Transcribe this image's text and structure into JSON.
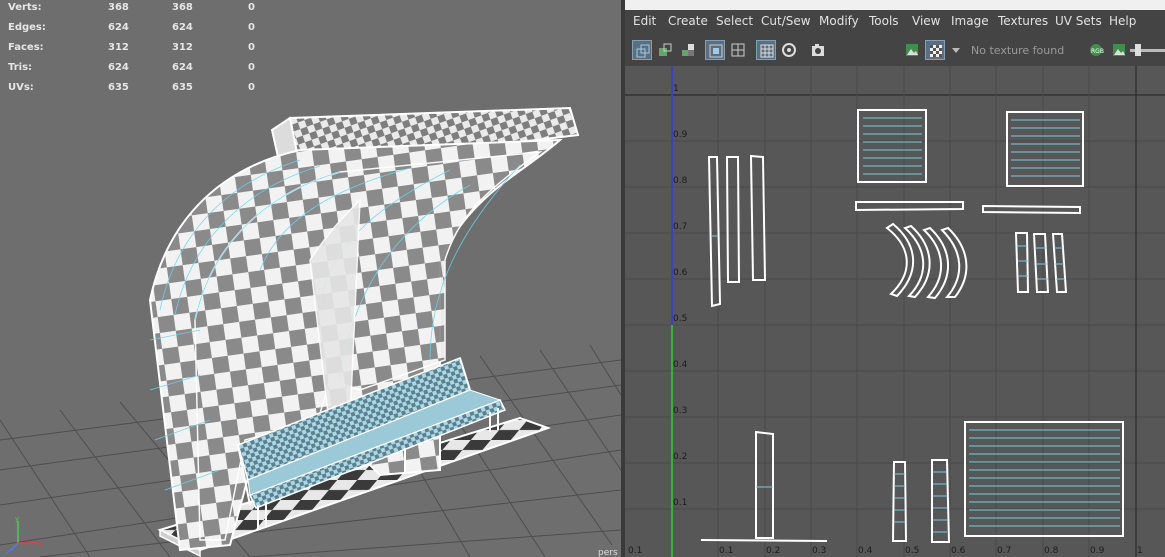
{
  "stats": {
    "rows": [
      {
        "label": "Verts:",
        "v1": "368",
        "v2": "368",
        "v3": "0"
      },
      {
        "label": "Edges:",
        "v1": "624",
        "v2": "624",
        "v3": "0"
      },
      {
        "label": "Faces:",
        "v1": "312",
        "v2": "312",
        "v3": "0"
      },
      {
        "label": "Tris:",
        "v1": "624",
        "v2": "624",
        "v3": "0"
      },
      {
        "label": "UVs:",
        "v1": "635",
        "v2": "635",
        "v3": "0"
      }
    ]
  },
  "viewport": {
    "camera_label": "pers"
  },
  "uv_editor": {
    "menu": [
      "Edit",
      "Create",
      "Select",
      "Cut/Sew",
      "Modify",
      "Tools",
      "View",
      "Image",
      "Textures",
      "UV Sets",
      "Help"
    ],
    "texture_status": "No texture found",
    "v_ticks": [
      "1",
      "0.9",
      "0.8",
      "0.7",
      "0.6",
      "0.5",
      "0.4",
      "0.3",
      "0.2",
      "0.1"
    ],
    "u_ticks": [
      "0.1",
      "0.1",
      "0.2",
      "0.3",
      "0.4",
      "0.5",
      "0.6",
      "0.7",
      "0.8",
      "0.9",
      "1"
    ]
  },
  "colors": {
    "uv_shell": "#ffffff",
    "uv_edge": "#7ec8e3",
    "v_axis": "#3b3fc8",
    "u_axis": "#2fb82f",
    "wire": "#6ad4f2"
  }
}
